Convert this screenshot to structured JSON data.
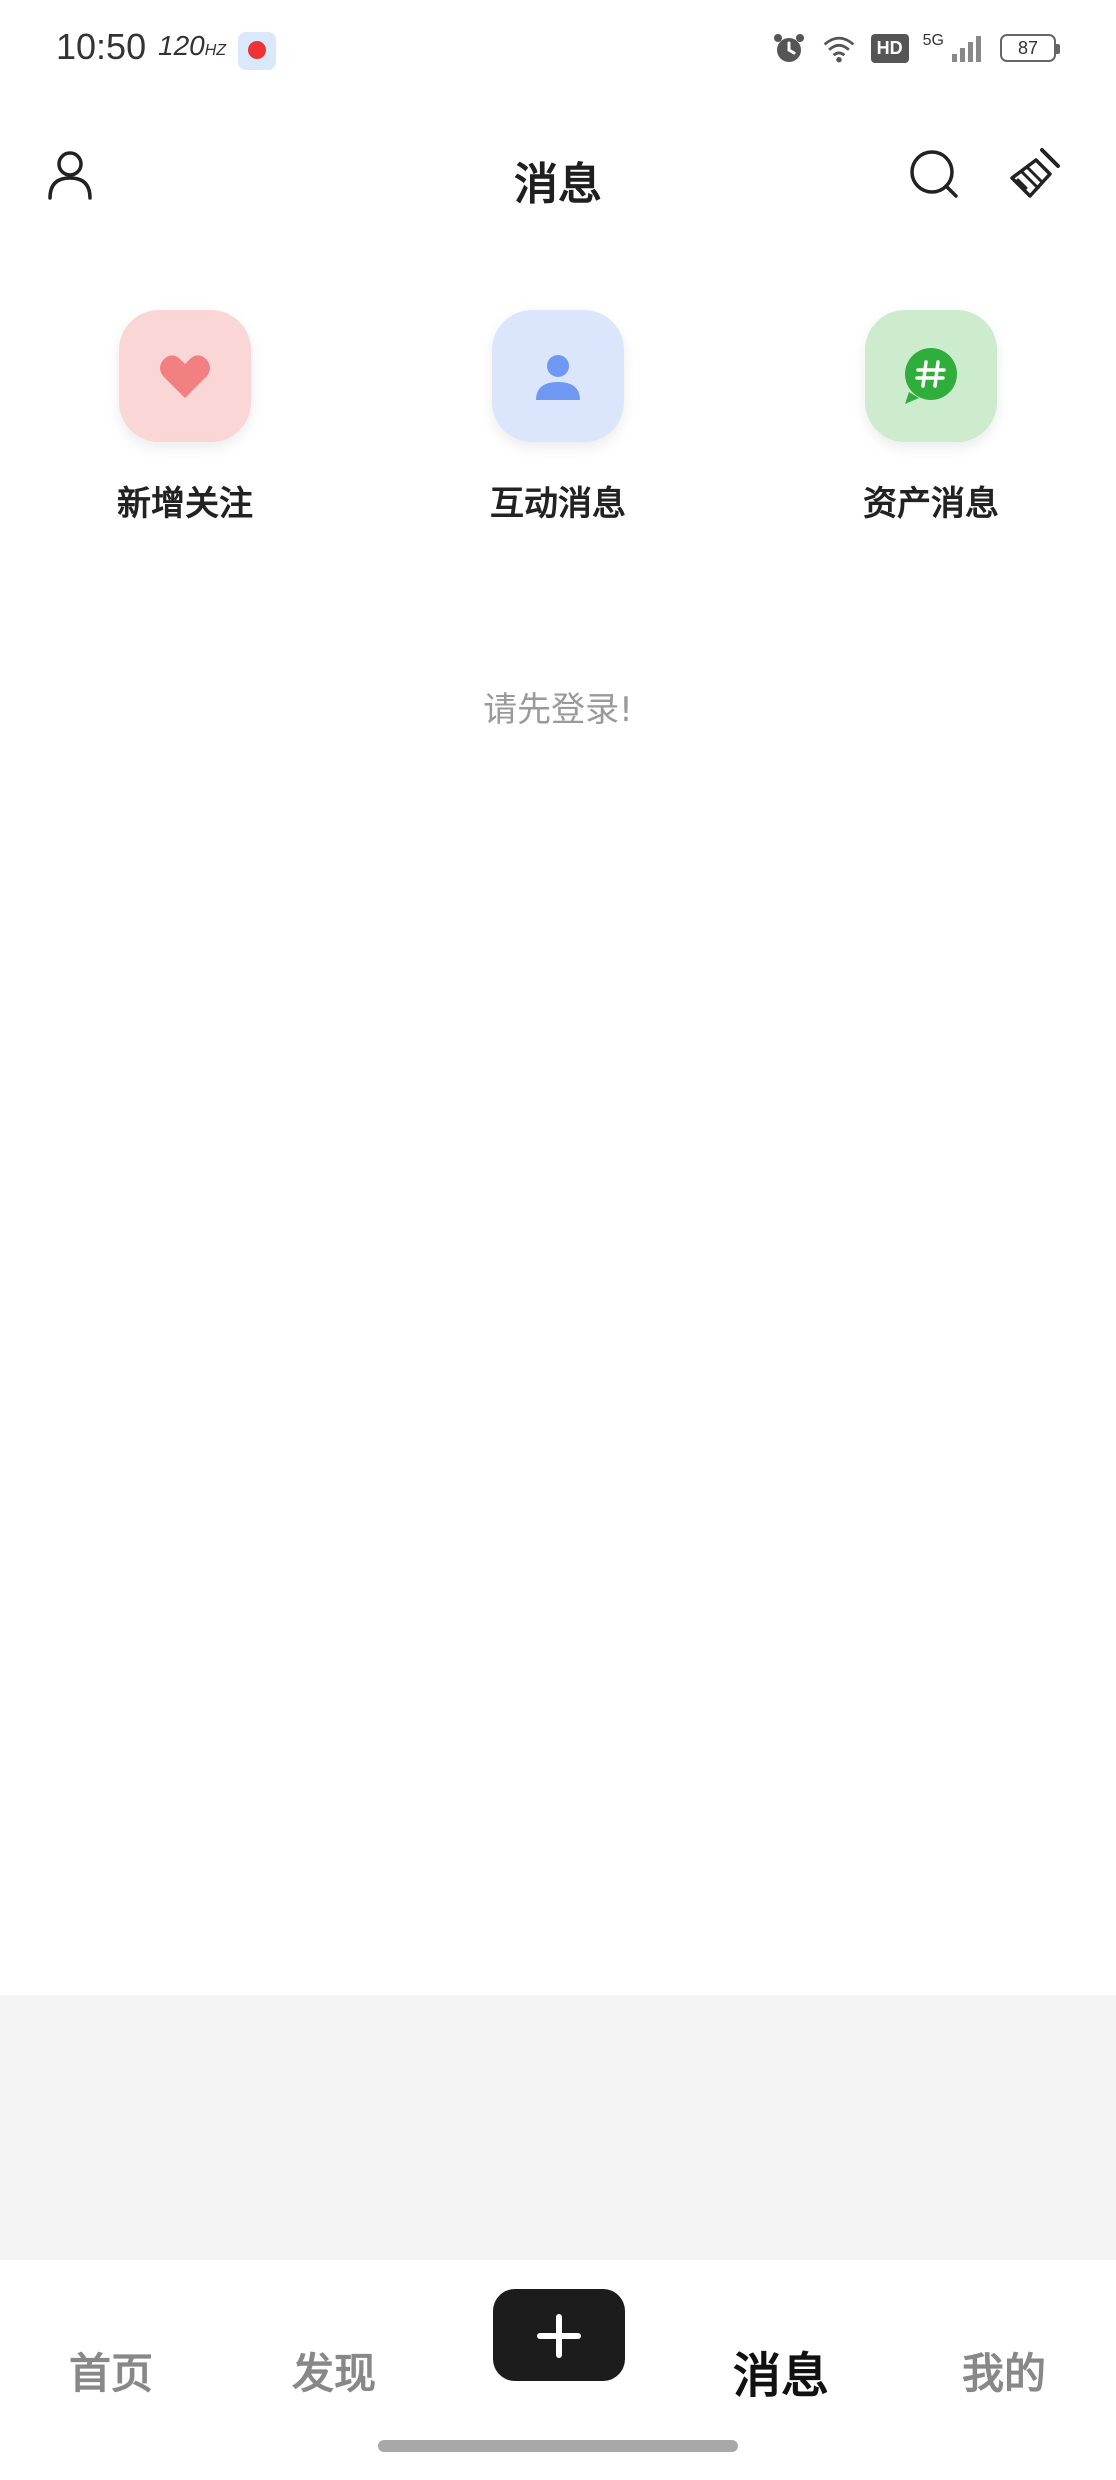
{
  "status_bar": {
    "time": "10:50",
    "refresh_rate": "120",
    "battery": "87",
    "network": "5G",
    "hd_label": "HD"
  },
  "header": {
    "title": "消息",
    "icons": [
      "user-icon",
      "search-icon",
      "clean-brush-icon"
    ]
  },
  "categories": [
    {
      "label": "新增关注",
      "icon": "heart-icon",
      "color": "#f28080"
    },
    {
      "label": "互动消息",
      "icon": "person-icon",
      "color": "#6f98f2"
    },
    {
      "label": "资产消息",
      "icon": "hashtag-chat-icon",
      "color": "#2fae3c"
    }
  ],
  "main": {
    "empty_message": "请先登录!"
  },
  "bottom_nav": {
    "items": [
      {
        "label": "首页",
        "active": false
      },
      {
        "label": "发现",
        "active": false
      },
      {
        "label": "消息",
        "active": true
      },
      {
        "label": "我的",
        "active": false
      }
    ],
    "add_icon": "plus-icon"
  },
  "colors": {
    "accent_dark": "#1c1c1c",
    "grey_area": "#f4f4f4",
    "tile_pink": "#fbd6d6",
    "tile_blue": "#dbe6fd",
    "tile_green": "#cdebcd"
  }
}
